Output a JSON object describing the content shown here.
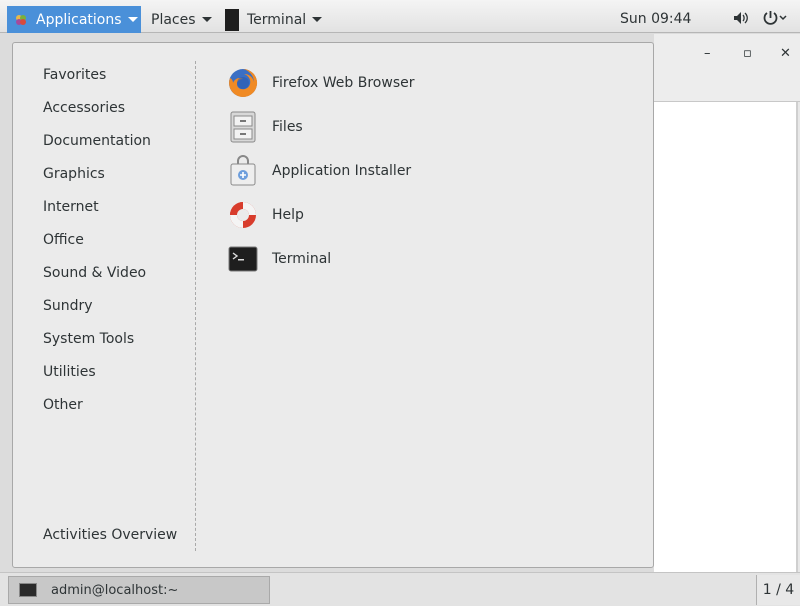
{
  "top_panel": {
    "applications_label": "Applications",
    "places_label": "Places",
    "terminal_label": "Terminal",
    "clock": "Sun 09:44",
    "icons": [
      "applications-logo-icon",
      "terminal-icon",
      "volume-icon",
      "power-icon"
    ]
  },
  "apps_menu": {
    "categories": [
      {
        "label": "Favorites"
      },
      {
        "label": "Accessories"
      },
      {
        "label": "Documentation"
      },
      {
        "label": "Graphics"
      },
      {
        "label": "Internet"
      },
      {
        "label": "Office"
      },
      {
        "label": "Sound & Video"
      },
      {
        "label": "Sundry"
      },
      {
        "label": "System Tools"
      },
      {
        "label": "Utilities"
      },
      {
        "label": "Other"
      }
    ],
    "activities_overview": "Activities Overview",
    "apps": [
      {
        "label": "Firefox Web Browser",
        "icon": "firefox-icon"
      },
      {
        "label": "Files",
        "icon": "files-icon"
      },
      {
        "label": "Application Installer",
        "icon": "installer-icon"
      },
      {
        "label": "Help",
        "icon": "help-icon"
      },
      {
        "label": "Terminal",
        "icon": "terminal-icon"
      }
    ]
  },
  "background_window": {
    "buttons": [
      "minimize-icon",
      "maximize-icon",
      "close-icon"
    ]
  },
  "bottom_panel": {
    "task_label": "admin@localhost:~",
    "workspace": "1 / 4"
  },
  "colors": {
    "accent": "#4a90d9",
    "panel": "#e6e6e6",
    "menu_bg": "#ebebeb"
  }
}
